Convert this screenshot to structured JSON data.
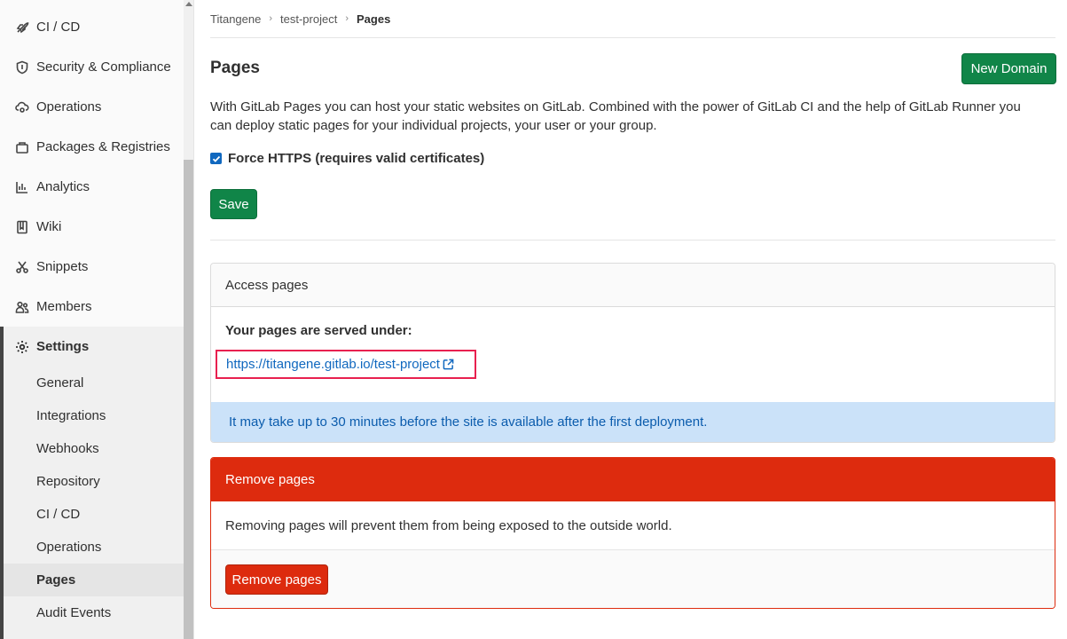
{
  "sidebar": {
    "items": [
      {
        "label": "CI / CD",
        "icon": "rocket-icon"
      },
      {
        "label": "Security & Compliance",
        "icon": "shield-icon"
      },
      {
        "label": "Operations",
        "icon": "cloud-gear-icon"
      },
      {
        "label": "Packages & Registries",
        "icon": "package-icon"
      },
      {
        "label": "Analytics",
        "icon": "chart-icon"
      },
      {
        "label": "Wiki",
        "icon": "book-icon"
      },
      {
        "label": "Snippets",
        "icon": "scissors-icon"
      },
      {
        "label": "Members",
        "icon": "users-icon"
      }
    ],
    "settings": {
      "label": "Settings",
      "icon": "gear-icon",
      "subitems": [
        {
          "label": "General"
        },
        {
          "label": "Integrations"
        },
        {
          "label": "Webhooks"
        },
        {
          "label": "Repository"
        },
        {
          "label": "CI / CD"
        },
        {
          "label": "Operations"
        },
        {
          "label": "Pages",
          "active": true
        },
        {
          "label": "Audit Events"
        }
      ]
    }
  },
  "breadcrumb": {
    "items": [
      "Titangene",
      "test-project"
    ],
    "current": "Pages"
  },
  "page": {
    "title": "Pages",
    "new_domain_label": "New Domain",
    "intro": "With GitLab Pages you can host your static websites on GitLab. Combined with the power of GitLab CI and the help of GitLab Runner you can deploy static pages for your individual projects, your user or your group.",
    "force_https_label": "Force HTTPS (requires valid certificates)",
    "force_https_checked": true,
    "save_label": "Save"
  },
  "access": {
    "header": "Access pages",
    "served_label": "Your pages are served under:",
    "url": "https://titangene.gitlab.io/test-project",
    "info": "It may take up to 30 minutes before the site is available after the first deployment."
  },
  "remove": {
    "header": "Remove pages",
    "body": "Removing pages will prevent them from being exposed to the outside world.",
    "button_label": "Remove pages"
  },
  "colors": {
    "green": "#108548",
    "danger": "#dd2b0e",
    "link": "#1068bf",
    "info_bg": "#cbe2f9",
    "highlight": "#e8204f"
  }
}
